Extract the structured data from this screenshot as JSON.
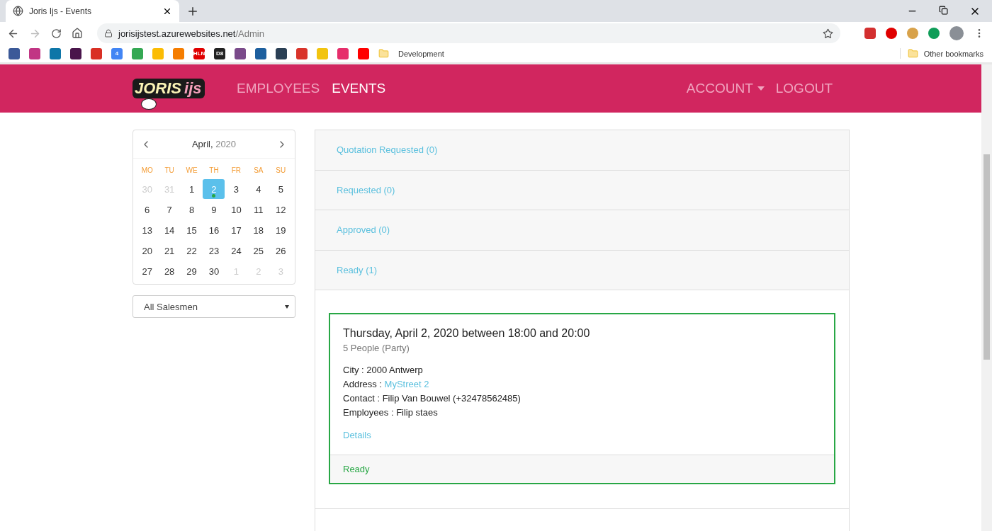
{
  "browser": {
    "tab_title": "Joris Ijs - Events",
    "url_host": "jorisijstest.azurewebsites.net",
    "url_path": "/Admin",
    "bookmarks": [
      {
        "color": "#3b5998"
      },
      {
        "color": "#c13584"
      },
      {
        "color": "#0e76a8"
      },
      {
        "color": "#4a154b"
      },
      {
        "color": "#d93025"
      },
      {
        "color": "#4285f4",
        "label": "4"
      },
      {
        "color": "#34a853"
      },
      {
        "color": "#fbbc04"
      },
      {
        "color": "#f57d00"
      },
      {
        "color": "#e00000",
        "label": "HLN"
      },
      {
        "color": "#222222",
        "label": "D8"
      },
      {
        "color": "#7a4a8a"
      },
      {
        "color": "#1d5f9e"
      },
      {
        "color": "#2a3f54"
      },
      {
        "color": "#d9342b"
      },
      {
        "color": "#f2c40f"
      },
      {
        "color": "#e62e6b"
      },
      {
        "color": "#ff0000"
      }
    ],
    "bookmark_folder": "Development",
    "other_bookmarks": "Other bookmarks"
  },
  "navbar": {
    "logo_main": "JORIS",
    "logo_accent": "ijs",
    "links": [
      {
        "label": "EMPLOYEES",
        "selected": false
      },
      {
        "label": "EVENTS",
        "selected": true
      }
    ],
    "account": "ACCOUNT",
    "logout": "LOGOUT"
  },
  "calendar": {
    "month": "April,",
    "year": "2020",
    "weekdays": [
      "MO",
      "TU",
      "WE",
      "TH",
      "FR",
      "SA",
      "SU"
    ],
    "weeks": [
      [
        {
          "day": "30",
          "outside": true,
          "selected": false,
          "event": false
        },
        {
          "day": "31",
          "outside": true,
          "selected": false,
          "event": false
        },
        {
          "day": "1",
          "outside": false,
          "selected": false,
          "event": false
        },
        {
          "day": "2",
          "outside": false,
          "selected": true,
          "event": true
        },
        {
          "day": "3",
          "outside": false,
          "selected": false,
          "event": false
        },
        {
          "day": "4",
          "outside": false,
          "selected": false,
          "event": false
        },
        {
          "day": "5",
          "outside": false,
          "selected": false,
          "event": false
        }
      ],
      [
        {
          "day": "6",
          "outside": false,
          "selected": false,
          "event": false
        },
        {
          "day": "7",
          "outside": false,
          "selected": false,
          "event": false
        },
        {
          "day": "8",
          "outside": false,
          "selected": false,
          "event": false
        },
        {
          "day": "9",
          "outside": false,
          "selected": false,
          "event": false
        },
        {
          "day": "10",
          "outside": false,
          "selected": false,
          "event": false
        },
        {
          "day": "11",
          "outside": false,
          "selected": false,
          "event": false
        },
        {
          "day": "12",
          "outside": false,
          "selected": false,
          "event": false
        }
      ],
      [
        {
          "day": "13",
          "outside": false,
          "selected": false,
          "event": false
        },
        {
          "day": "14",
          "outside": false,
          "selected": false,
          "event": false
        },
        {
          "day": "15",
          "outside": false,
          "selected": false,
          "event": false
        },
        {
          "day": "16",
          "outside": false,
          "selected": false,
          "event": false
        },
        {
          "day": "17",
          "outside": false,
          "selected": false,
          "event": false
        },
        {
          "day": "18",
          "outside": false,
          "selected": false,
          "event": false
        },
        {
          "day": "19",
          "outside": false,
          "selected": false,
          "event": false
        }
      ],
      [
        {
          "day": "20",
          "outside": false,
          "selected": false,
          "event": false
        },
        {
          "day": "21",
          "outside": false,
          "selected": false,
          "event": false
        },
        {
          "day": "22",
          "outside": false,
          "selected": false,
          "event": false
        },
        {
          "day": "23",
          "outside": false,
          "selected": false,
          "event": false
        },
        {
          "day": "24",
          "outside": false,
          "selected": false,
          "event": false
        },
        {
          "day": "25",
          "outside": false,
          "selected": false,
          "event": false
        },
        {
          "day": "26",
          "outside": false,
          "selected": false,
          "event": false
        }
      ],
      [
        {
          "day": "27",
          "outside": false,
          "selected": false,
          "event": false
        },
        {
          "day": "28",
          "outside": false,
          "selected": false,
          "event": false
        },
        {
          "day": "29",
          "outside": false,
          "selected": false,
          "event": false
        },
        {
          "day": "30",
          "outside": false,
          "selected": false,
          "event": false
        },
        {
          "day": "1",
          "outside": true,
          "selected": false,
          "event": false
        },
        {
          "day": "2",
          "outside": true,
          "selected": false,
          "event": false
        },
        {
          "day": "3",
          "outside": true,
          "selected": false,
          "event": false
        }
      ]
    ]
  },
  "salesman_select": {
    "value": "All Salesmen"
  },
  "sections": [
    {
      "title": "Quotation Requested (0)",
      "expanded": false
    },
    {
      "title": "Requested (0)",
      "expanded": false
    },
    {
      "title": "Approved (0)",
      "expanded": false
    },
    {
      "title": "Ready (1)",
      "expanded": true
    }
  ],
  "event_card": {
    "title": "Thursday, April 2, 2020 between 18:00 and 20:00",
    "subtitle": "5 People (Party)",
    "city": "City : 2000 Antwerp",
    "address_label": "Address :",
    "address_link": "MyStreet 2",
    "contact": "Contact : Filip Van Bouwel (+32478562485)",
    "employees": "Employees : Filip staes",
    "details": "Details",
    "status": "Ready"
  }
}
